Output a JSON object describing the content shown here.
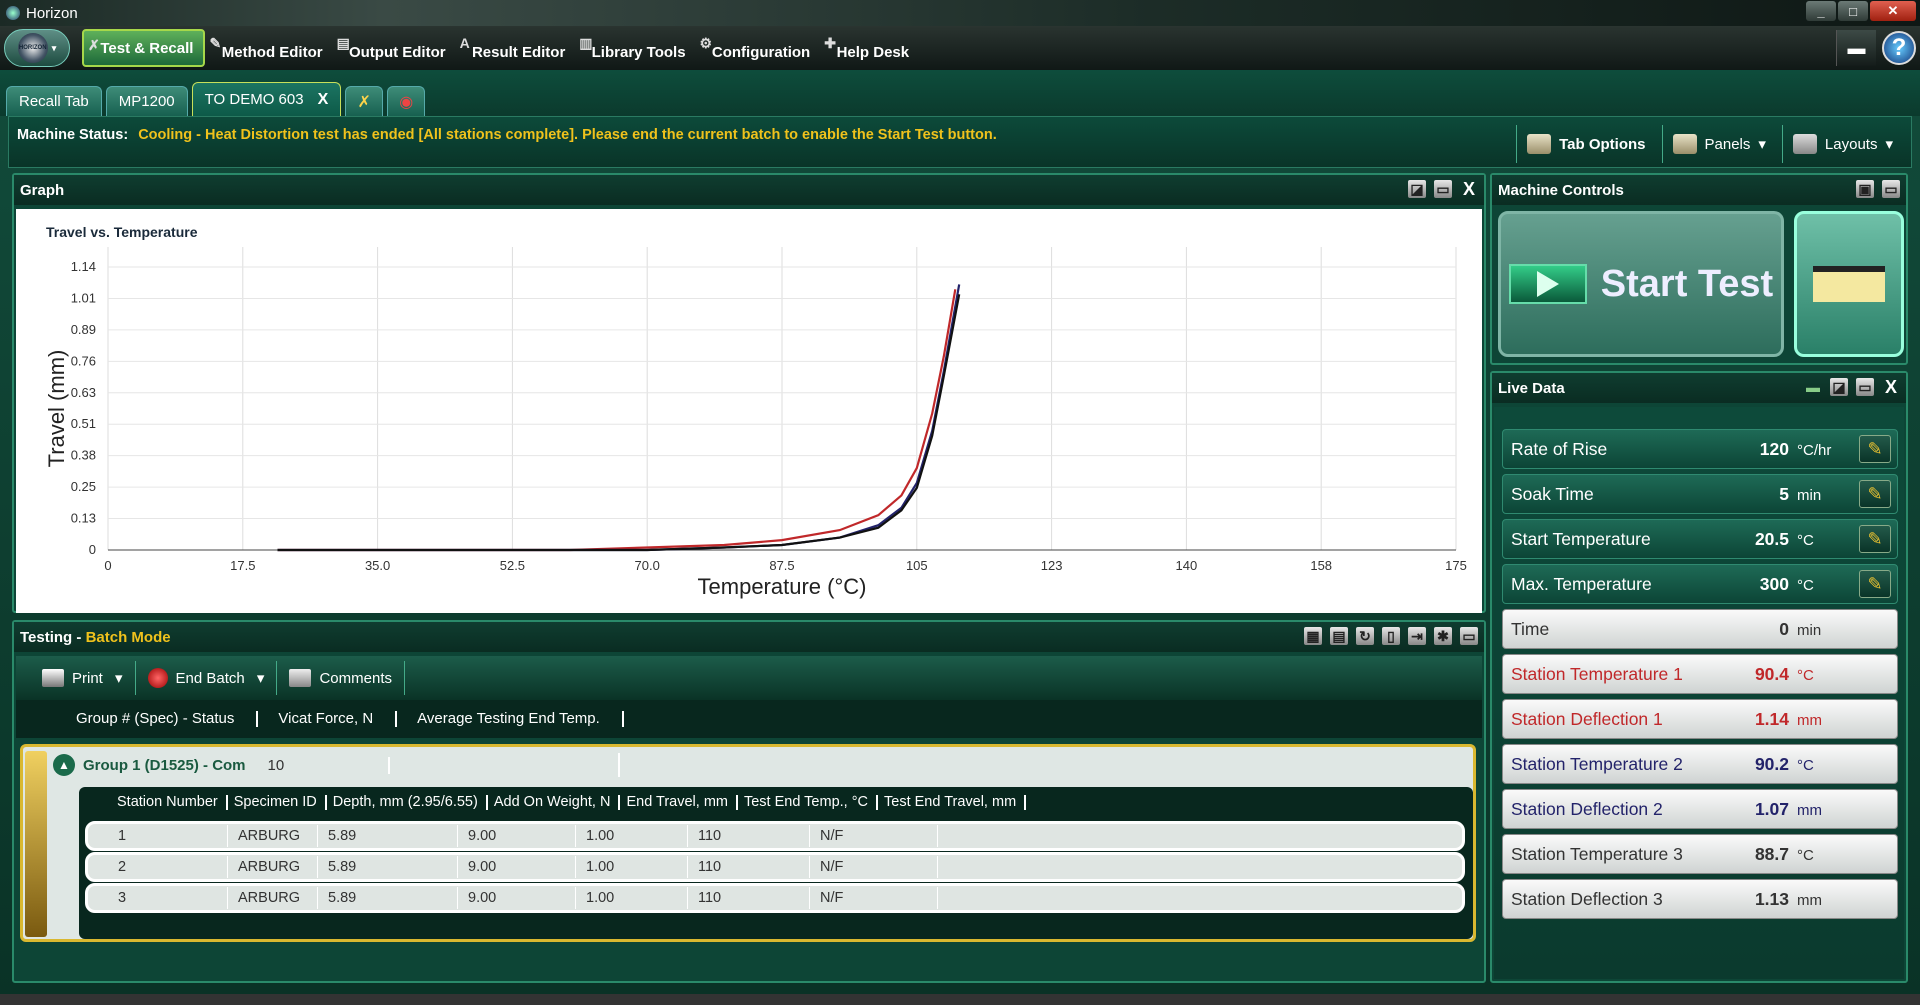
{
  "app": {
    "title": "Horizon",
    "logo_text": "HORIZON"
  },
  "menu": {
    "items": [
      {
        "label": "Test & Recall",
        "icon": "test-recall-icon",
        "active": true
      },
      {
        "label": "Method Editor",
        "icon": "method-editor-icon"
      },
      {
        "label": "Output Editor",
        "icon": "output-editor-icon"
      },
      {
        "label": "Result Editor",
        "icon": "result-editor-icon"
      },
      {
        "label": "Library Tools",
        "icon": "library-tools-icon"
      },
      {
        "label": "Configuration",
        "icon": "configuration-icon"
      },
      {
        "label": "Help Desk",
        "icon": "help-desk-icon"
      }
    ],
    "help": "?"
  },
  "tabs": [
    {
      "label": "Recall Tab"
    },
    {
      "label": "MP1200"
    },
    {
      "label": "TO DEMO 603",
      "active": true,
      "close": "X"
    }
  ],
  "status": {
    "label": "Machine Status:",
    "message": "Cooling - Heat Distortion test has ended [All stations complete]. Please end the current batch to enable the Start Test button."
  },
  "toolbar": {
    "tab_options": "Tab Options",
    "panels": "Panels",
    "layouts": "Layouts"
  },
  "graph": {
    "panel_title": "Graph",
    "close": "X"
  },
  "chart_data": {
    "type": "line",
    "title": "Travel vs. Temperature",
    "xlabel": "Temperature (°C)",
    "ylabel": "Travel (mm)",
    "xlim": [
      0,
      175
    ],
    "ylim": [
      0,
      1.14
    ],
    "xticks": [
      "0",
      "17.5",
      "35.0",
      "52.5",
      "70.0",
      "87.5",
      "105",
      "123",
      "140",
      "158",
      "175"
    ],
    "yticks": [
      "0",
      "0.13",
      "0.25",
      "0.38",
      "0.51",
      "0.63",
      "0.76",
      "0.89",
      "1.01",
      "1.14"
    ],
    "grid": true,
    "series": [
      {
        "color": "#c0282a",
        "x": [
          22,
          40,
          60,
          70,
          80,
          87.5,
          95,
          100,
          103,
          105,
          107,
          108.5,
          110
        ],
        "y": [
          0.0,
          0.0,
          0.0,
          0.01,
          0.02,
          0.04,
          0.08,
          0.14,
          0.22,
          0.33,
          0.55,
          0.78,
          1.05
        ]
      },
      {
        "color": "#23236a",
        "x": [
          22,
          40,
          60,
          70,
          80,
          87.5,
          95,
          100,
          103,
          105,
          107,
          108.5,
          110.5
        ],
        "y": [
          0.0,
          0.0,
          0.0,
          0.0,
          0.01,
          0.02,
          0.05,
          0.1,
          0.17,
          0.27,
          0.48,
          0.72,
          1.07
        ]
      },
      {
        "color": "#111111",
        "x": [
          22,
          40,
          60,
          70,
          80,
          87.5,
          95,
          100,
          103,
          105,
          107,
          108.5,
          110.5
        ],
        "y": [
          0.0,
          0.0,
          0.0,
          0.0,
          0.01,
          0.02,
          0.05,
          0.09,
          0.16,
          0.25,
          0.46,
          0.7,
          1.03
        ]
      }
    ]
  },
  "machine_controls": {
    "title": "Machine Controls",
    "start_test": "Start Test"
  },
  "live_data": {
    "title": "Live Data",
    "close": "X",
    "rows": [
      {
        "label": "Rate of Rise",
        "value": "120",
        "unit": "°C/hr",
        "style": "dark",
        "editable": true
      },
      {
        "label": "Soak Time",
        "value": "5",
        "unit": "min",
        "style": "dark",
        "editable": true
      },
      {
        "label": "Start Temperature",
        "value": "20.5",
        "unit": "°C",
        "style": "dark",
        "editable": true
      },
      {
        "label": "Max. Temperature",
        "value": "300",
        "unit": "°C",
        "style": "dark",
        "editable": true
      },
      {
        "label": "Time",
        "value": "0",
        "unit": "min",
        "style": "light"
      },
      {
        "label": "Station Temperature 1",
        "value": "90.4",
        "unit": "°C",
        "style": "light",
        "color": "red"
      },
      {
        "label": "Station Deflection 1",
        "value": "1.14",
        "unit": "mm",
        "style": "light",
        "color": "red"
      },
      {
        "label": "Station Temperature 2",
        "value": "90.2",
        "unit": "°C",
        "style": "light",
        "color": "navy"
      },
      {
        "label": "Station Deflection 2",
        "value": "1.07",
        "unit": "mm",
        "style": "light",
        "color": "navy"
      },
      {
        "label": "Station Temperature 3",
        "value": "88.7",
        "unit": "°C",
        "style": "light"
      },
      {
        "label": "Station Deflection 3",
        "value": "1.13",
        "unit": "mm",
        "style": "light"
      }
    ]
  },
  "testing": {
    "title": "Testing -",
    "mode": "Batch Mode",
    "buttons": {
      "print": "Print",
      "end_batch": "End Batch",
      "comments": "Comments"
    },
    "columns": [
      "Group # (Spec) - Status",
      "Vicat Force, N",
      "Average Testing End Temp."
    ],
    "group": {
      "label": "Group 1 (D1525)  -  Com",
      "count": "10"
    },
    "station_columns": [
      "Station Number",
      "Specimen ID",
      "Depth, mm (2.95/6.55)",
      "Add On Weight, N",
      "End Travel, mm",
      "Test End Temp., °C",
      "Test End Travel, mm"
    ],
    "stations": [
      [
        "1",
        "ARBURG",
        "5.89",
        "9.00",
        "1.00",
        "110",
        "N/F"
      ],
      [
        "2",
        "ARBURG",
        "5.89",
        "9.00",
        "1.00",
        "110",
        "N/F"
      ],
      [
        "3",
        "ARBURG",
        "5.89",
        "9.00",
        "1.00",
        "110",
        "N/F"
      ]
    ]
  }
}
